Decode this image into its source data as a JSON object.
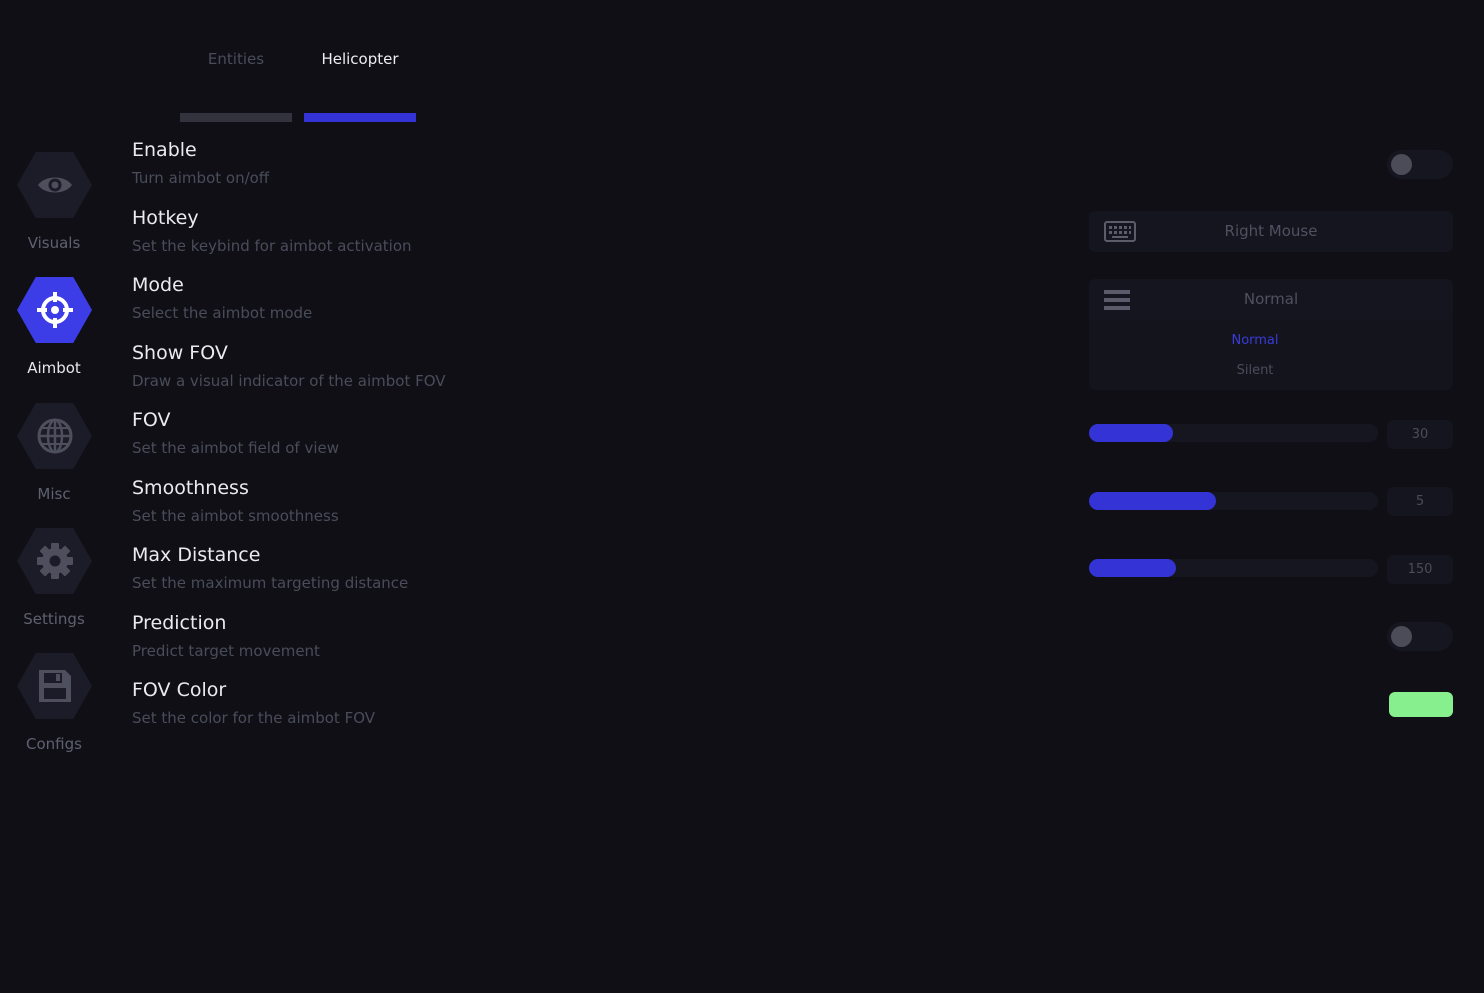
{
  "sidebar": {
    "items": [
      {
        "label": "Visuals",
        "icon": "eye-icon",
        "active": false
      },
      {
        "label": "Aimbot",
        "icon": "crosshair-icon",
        "active": true
      },
      {
        "label": "Misc",
        "icon": "globe-icon",
        "active": false
      },
      {
        "label": "Settings",
        "icon": "gear-icon",
        "active": false
      },
      {
        "label": "Configs",
        "icon": "floppy-disk-icon",
        "active": false
      }
    ]
  },
  "tabs": [
    {
      "label": "Entities",
      "active": false
    },
    {
      "label": "Helicopter",
      "active": true
    }
  ],
  "settings": [
    {
      "title": "Enable",
      "description": "Turn aimbot on/off"
    },
    {
      "title": "Hotkey",
      "description": "Set the keybind for aimbot activation"
    },
    {
      "title": "Mode",
      "description": "Select the aimbot mode"
    },
    {
      "title": "Show FOV",
      "description": "Draw a visual indicator of the aimbot FOV"
    },
    {
      "title": "FOV",
      "description": "Set the aimbot field of view"
    },
    {
      "title": "Smoothness",
      "description": "Set the aimbot smoothness"
    },
    {
      "title": "Max Distance",
      "description": "Set the maximum targeting distance"
    },
    {
      "title": "Prediction",
      "description": "Predict target movement"
    },
    {
      "title": "FOV Color",
      "description": "Set the color for the aimbot FOV"
    }
  ],
  "controls": {
    "enable_toggle": {
      "on": false
    },
    "hotkey": {
      "value": "Right Mouse",
      "icon": "keyboard-icon"
    },
    "mode": {
      "selected": "Normal",
      "icon": "menu-icon",
      "options": [
        "Normal",
        "Silent"
      ]
    },
    "fov": {
      "value": "30",
      "fill_fraction": 0.29
    },
    "smoothness": {
      "value": "5",
      "fill_fraction": 0.44
    },
    "max_distance": {
      "value": "150",
      "fill_fraction": 0.3
    },
    "prediction_toggle": {
      "on": false
    },
    "fov_color": {
      "color": "#88ef8f"
    }
  },
  "colors": {
    "accent": "#3c3de6",
    "background": "#0f0f15",
    "muted_text": "#4a4c5a",
    "swatch": "#88ef8f"
  }
}
